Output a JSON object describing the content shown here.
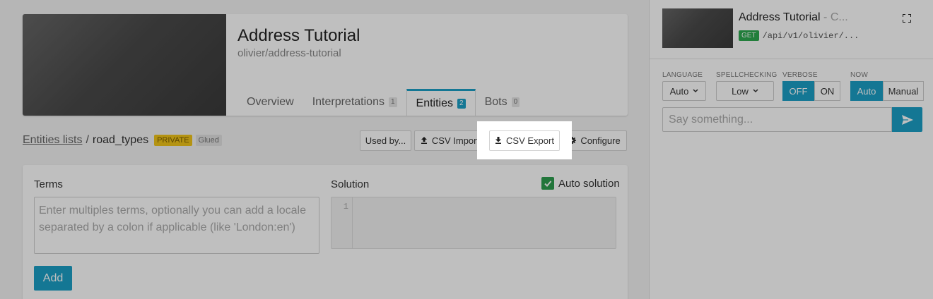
{
  "header": {
    "title": "Address Tutorial",
    "slug": "olivier/address-tutorial",
    "tabs": [
      {
        "label": "Overview",
        "count": null
      },
      {
        "label": "Interpretations",
        "count": "1"
      },
      {
        "label": "Entities",
        "count": "2"
      },
      {
        "label": "Bots",
        "count": "0"
      }
    ]
  },
  "breadcrumb": {
    "link": "Entities lists",
    "separator": "/",
    "current": "road_types",
    "badge_private": "PRIVATE",
    "badge_glued": "Glued"
  },
  "toolbar": {
    "used_by": "Used by...",
    "csv_import": "CSV Import",
    "csv_export": "CSV Export",
    "configure": "Configure"
  },
  "form": {
    "terms_label": "Terms",
    "terms_placeholder": "Enter multiples terms, optionally you can add a locale separated by a colon if applicable (like 'London:en')",
    "solution_label": "Solution",
    "line_number": "1",
    "auto_solution_label": "Auto solution",
    "auto_solution_checked": true,
    "add_label": "Add"
  },
  "panel": {
    "title": "Address Tutorial",
    "title_suffix": " - C...",
    "method": "GET",
    "endpoint": "/api/v1/olivier/...",
    "language_label": "LANGUAGE",
    "language_value": "Auto",
    "spellchecking_label": "SPELLCHECKING",
    "spellchecking_value": "Low",
    "verbose_label": "VERBOSE",
    "verbose_off": "OFF",
    "verbose_on": "ON",
    "now_label": "NOW",
    "now_auto": "Auto",
    "now_manual": "Manual",
    "say_placeholder": "Say something..."
  },
  "colors": {
    "accent": "#1b9fc6",
    "success": "#2e9e4f",
    "private_badge": "#f0c419"
  }
}
